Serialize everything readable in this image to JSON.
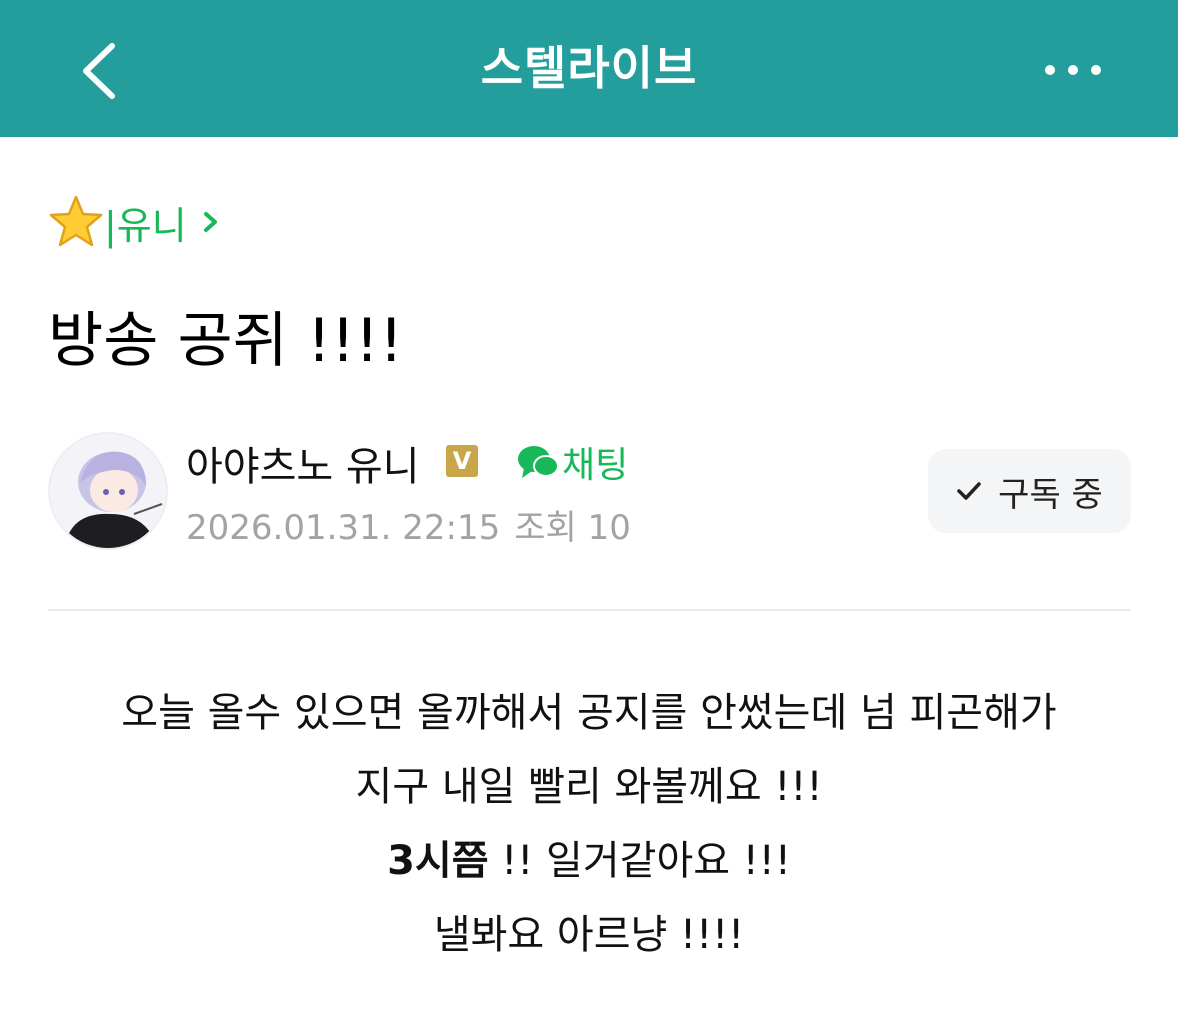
{
  "header": {
    "title": "스텔라이브",
    "back_icon": "chevron-left-icon",
    "more_icon": "more-horizontal-icon",
    "bg_color": "#239e9c"
  },
  "board": {
    "icon": "star-icon",
    "label": "|유니",
    "chevron_icon": "chevron-right-icon",
    "color": "#18b85a"
  },
  "post": {
    "title": "방송 공쥐 !!!!",
    "author": {
      "name": "아야츠노 유니",
      "badge": "V",
      "chat_label": "채팅",
      "date": "2026.01.31. 22:15",
      "views": "조회 10"
    },
    "subscribe_label": "구독 중",
    "body": {
      "line1": "오늘 올수 있으면 올까해서 공지를 안썼는데 넘 피곤해가",
      "line2": "지구 내일 빨리 와볼께요 !!!",
      "line3_bold": "3시쯤",
      "line3_rest": " !! 일거같아요 !!!",
      "line4": "낼봐요 아르냥 !!!!"
    }
  }
}
